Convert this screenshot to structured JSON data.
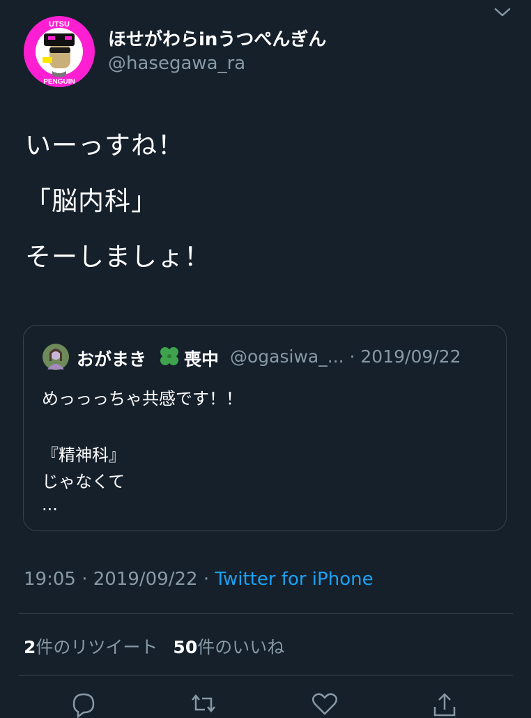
{
  "tweet": {
    "display_name": "ほせがわらinうつぺんぎん",
    "handle": "@hasegawa_ra",
    "avatar_text_top": "UTSU",
    "avatar_text_bottom": "PENGUIN",
    "lines": [
      "いーっすね！",
      "「脳内科」",
      "そーしましょ！"
    ],
    "time": "19:05",
    "sep": " · ",
    "date": "2019/09/22",
    "source": "Twitter for iPhone"
  },
  "quote": {
    "name": "おがまき",
    "name_suffix": "喪中",
    "handle_date": "@ogasiwa_... · 2019/09/22",
    "lines": [
      "めっっっちゃ共感です！！",
      "『精神科』",
      "じゃなくて",
      "..."
    ]
  },
  "stats": {
    "retweets_count": "2",
    "retweets_label": "件のリツイート",
    "likes_count": "50",
    "likes_label": "件のいいね"
  },
  "icons": {
    "caret": "chevron-down-icon",
    "reply": "reply-icon",
    "retweet": "retweet-icon",
    "like": "heart-icon",
    "share": "share-icon",
    "clover": "four-leaf-clover-icon"
  },
  "colors": {
    "background": "#15202b",
    "border": "#38444d",
    "muted": "#8899a6",
    "link": "#1da1f2",
    "avatar_ring": "#ff1fd2"
  }
}
